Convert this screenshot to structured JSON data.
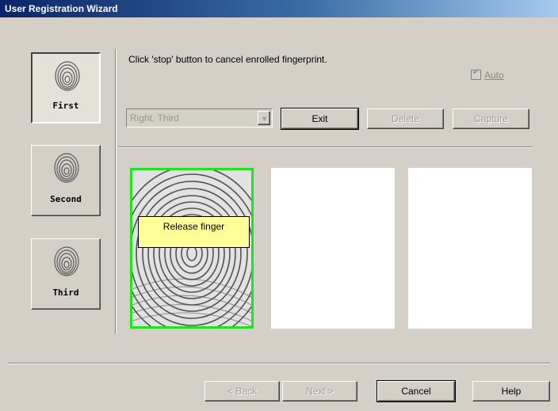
{
  "window": {
    "title": "User Registration Wizard"
  },
  "fingers": [
    {
      "label": "First",
      "icon": "fingerprint-icon",
      "active": true
    },
    {
      "label": "Second",
      "icon": "fingerprint-icon",
      "active": false
    },
    {
      "label": "Third",
      "icon": "fingerprint-icon",
      "active": false
    }
  ],
  "instruction": "Click 'stop' button to cancel enrolled fingerprint.",
  "auto": {
    "label": "Auto",
    "checked": true,
    "enabled": false
  },
  "finger_select": {
    "value": "Right, Third",
    "enabled": false
  },
  "toolbar": {
    "exit_label": "Exit",
    "delete_label": "Delete",
    "capture_label": "Capture"
  },
  "capture_slots": [
    {
      "state": "captured",
      "tooltip": "Release finger"
    },
    {
      "state": "empty"
    },
    {
      "state": "empty"
    }
  ],
  "footer": {
    "back_label": "< Back",
    "next_label": "Next >",
    "cancel_label": "Cancel",
    "help_label": "Help"
  },
  "colors": {
    "title_start": "#0a246a",
    "capture_border": "#22e322",
    "tooltip_bg": "#ffff99",
    "face": "#d4d0c8"
  }
}
